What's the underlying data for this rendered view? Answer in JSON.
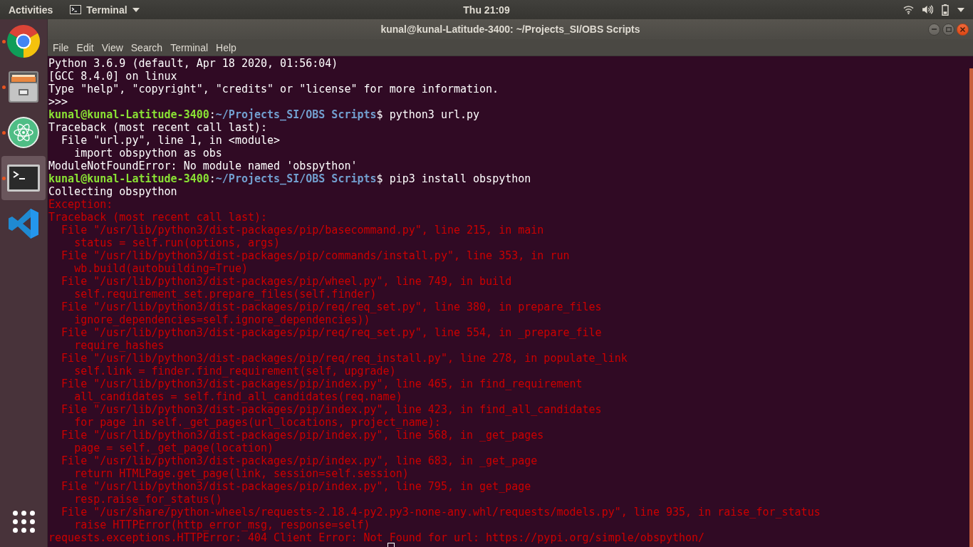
{
  "top_bar": {
    "activities": "Activities",
    "app_menu": "Terminal",
    "clock": "Thu 21:09"
  },
  "dock": {
    "items": [
      {
        "kind": "browser",
        "running": true,
        "selected": false
      },
      {
        "kind": "files",
        "running": true,
        "selected": false
      },
      {
        "kind": "atom",
        "running": true,
        "selected": false
      },
      {
        "kind": "terminal",
        "running": true,
        "selected": true
      },
      {
        "kind": "code-editor",
        "running": false,
        "selected": false
      }
    ]
  },
  "window": {
    "title": "kunal@kunal-Latitude-3400: ~/Projects_SI/OBS Scripts",
    "menu": [
      "File",
      "Edit",
      "View",
      "Search",
      "Terminal",
      "Help"
    ]
  },
  "terminal": {
    "lines": [
      {
        "kind": "output",
        "text": "Python 3.6.9 (default, Apr 18 2020, 01:56:04)"
      },
      {
        "kind": "output",
        "text": "[GCC 8.4.0] on linux"
      },
      {
        "kind": "output",
        "text": "Type \"help\", \"copyright\", \"credits\" or \"license\" for more information."
      },
      {
        "kind": "output",
        "text": ">>>"
      },
      {
        "kind": "prompt",
        "user": "kunal@kunal-Latitude-3400",
        "colon": ":",
        "path": "~/Projects_SI/OBS Scripts",
        "command": "$ python3 url.py"
      },
      {
        "kind": "output",
        "text": "Traceback (most recent call last):"
      },
      {
        "kind": "output",
        "text": "  File \"url.py\", line 1, in <module>"
      },
      {
        "kind": "output",
        "text": "    import obspython as obs"
      },
      {
        "kind": "output",
        "text": "ModuleNotFoundError: No module named 'obspython'"
      },
      {
        "kind": "prompt",
        "user": "kunal@kunal-Latitude-3400",
        "colon": ":",
        "path": "~/Projects_SI/OBS Scripts",
        "command": "$ pip3 install obspython"
      },
      {
        "kind": "output",
        "text": "Collecting obspython"
      },
      {
        "kind": "error",
        "text": "Exception:"
      },
      {
        "kind": "error",
        "text": "Traceback (most recent call last):"
      },
      {
        "kind": "error",
        "text": "  File \"/usr/lib/python3/dist-packages/pip/basecommand.py\", line 215, in main"
      },
      {
        "kind": "error",
        "text": "    status = self.run(options, args)"
      },
      {
        "kind": "error",
        "text": "  File \"/usr/lib/python3/dist-packages/pip/commands/install.py\", line 353, in run"
      },
      {
        "kind": "error",
        "text": "    wb.build(autobuilding=True)"
      },
      {
        "kind": "error",
        "text": "  File \"/usr/lib/python3/dist-packages/pip/wheel.py\", line 749, in build"
      },
      {
        "kind": "error",
        "text": "    self.requirement_set.prepare_files(self.finder)"
      },
      {
        "kind": "error",
        "text": "  File \"/usr/lib/python3/dist-packages/pip/req/req_set.py\", line 380, in prepare_files"
      },
      {
        "kind": "error",
        "text": "    ignore_dependencies=self.ignore_dependencies))"
      },
      {
        "kind": "error",
        "text": "  File \"/usr/lib/python3/dist-packages/pip/req/req_set.py\", line 554, in _prepare_file"
      },
      {
        "kind": "error",
        "text": "    require_hashes"
      },
      {
        "kind": "error",
        "text": "  File \"/usr/lib/python3/dist-packages/pip/req/req_install.py\", line 278, in populate_link"
      },
      {
        "kind": "error",
        "text": "    self.link = finder.find_requirement(self, upgrade)"
      },
      {
        "kind": "error",
        "text": "  File \"/usr/lib/python3/dist-packages/pip/index.py\", line 465, in find_requirement"
      },
      {
        "kind": "error",
        "text": "    all_candidates = self.find_all_candidates(req.name)"
      },
      {
        "kind": "error",
        "text": "  File \"/usr/lib/python3/dist-packages/pip/index.py\", line 423, in find_all_candidates"
      },
      {
        "kind": "error",
        "text": "    for page in self._get_pages(url_locations, project_name):"
      },
      {
        "kind": "error",
        "text": "  File \"/usr/lib/python3/dist-packages/pip/index.py\", line 568, in _get_pages"
      },
      {
        "kind": "error",
        "text": "    page = self._get_page(location)"
      },
      {
        "kind": "error",
        "text": "  File \"/usr/lib/python3/dist-packages/pip/index.py\", line 683, in _get_page"
      },
      {
        "kind": "error",
        "text": "    return HTMLPage.get_page(link, session=self.session)"
      },
      {
        "kind": "error",
        "text": "  File \"/usr/lib/python3/dist-packages/pip/index.py\", line 795, in get_page"
      },
      {
        "kind": "error",
        "text": "    resp.raise_for_status()"
      },
      {
        "kind": "error",
        "text": "  File \"/usr/share/python-wheels/requests-2.18.4-py2.py3-none-any.whl/requests/models.py\", line 935, in raise_for_status"
      },
      {
        "kind": "error",
        "text": "    raise HTTPError(http_error_msg, response=self)"
      },
      {
        "kind": "error",
        "text": "requests.exceptions.HTTPError: 404 Client Error: Not Found for url: https://pypi.org/simple/obspython/"
      }
    ]
  }
}
